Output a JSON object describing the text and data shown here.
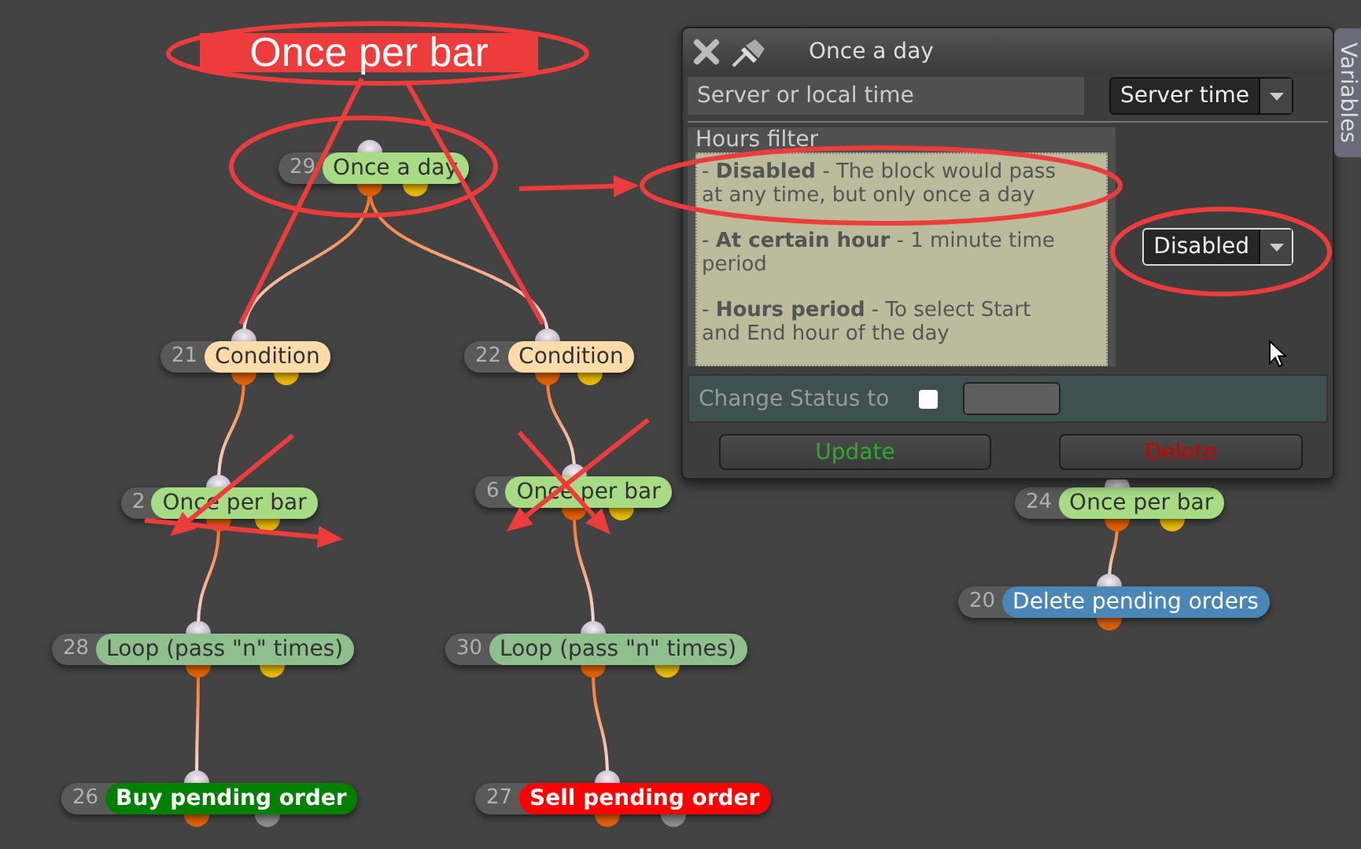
{
  "canvas": {
    "nodes": [
      {
        "number": "29",
        "label": "Once a day",
        "color": "#a8dc84",
        "kind": "block"
      },
      {
        "number": "21",
        "label": "Condition",
        "color": "#fddcaa",
        "kind": "block"
      },
      {
        "number": "22",
        "label": "Condition",
        "color": "#fddcaa",
        "kind": "block"
      },
      {
        "number": "2",
        "label": "Once per bar",
        "color": "#a8dc84",
        "kind": "block"
      },
      {
        "number": "6",
        "label": "Once per bar",
        "color": "#a8dc84",
        "kind": "block"
      },
      {
        "number": "28",
        "label": "Loop (pass \"n\" times)",
        "color": "#8fbf8c",
        "kind": "block"
      },
      {
        "number": "30",
        "label": "Loop (pass \"n\" times)",
        "color": "#8fbf8c",
        "kind": "block"
      },
      {
        "number": "26",
        "label": "Buy pending order",
        "color": "#008000",
        "kind": "order"
      },
      {
        "number": "27",
        "label": "Sell pending order",
        "color": "#ff0000",
        "kind": "order"
      },
      {
        "number": "24",
        "label": "Once per bar",
        "color": "#a8dc84",
        "kind": "block"
      },
      {
        "number": "20",
        "label": "Delete pending orders",
        "color": "#4a86b8",
        "kind": "action"
      }
    ]
  },
  "annotation": {
    "label": "Once per bar"
  },
  "dialog": {
    "title": "Once a day",
    "server_row": {
      "label": "Server or local time",
      "value": "Server time"
    },
    "hours_filter": {
      "label": "Hours filter",
      "value": "Disabled",
      "help": [
        "- **Disabled** - The block would pass at any time, but only once a day",
        "- **At certain hour** - 1 minute time period",
        "- **Hours period** - To select Start and End hour of the day"
      ]
    },
    "change_status": {
      "label": "Change Status to",
      "checked": false
    },
    "buttons": [
      {
        "label": "Update",
        "kind": "update"
      },
      {
        "label": "Delete",
        "kind": "delete"
      }
    ]
  },
  "side_tab": {
    "label": "Variables"
  }
}
